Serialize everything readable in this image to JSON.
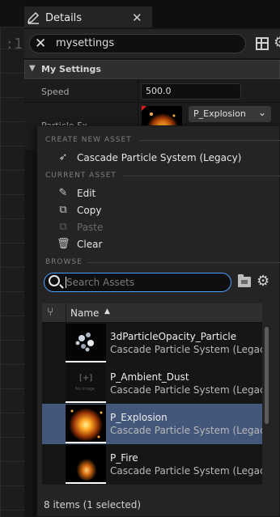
{
  "viewport": {
    "edge_text": ":1"
  },
  "tab": {
    "title": "Details",
    "icon": "pencil-icon",
    "close_icon": "close-icon"
  },
  "search": {
    "value": "mysettings"
  },
  "category": {
    "label": "My Settings"
  },
  "properties": [
    {
      "label": "Speed",
      "value": "500.0"
    },
    {
      "label": "Particle Fx",
      "value": "P_Explosion"
    }
  ],
  "menu": {
    "create_new_asset": {
      "header": "CREATE NEW ASSET",
      "item": "Cascade Particle System (Legacy)"
    },
    "current_asset": {
      "header": "CURRENT ASSET",
      "items": [
        "Edit",
        "Copy",
        "Paste",
        "Clear"
      ]
    },
    "browse": {
      "header": "BROWSE",
      "search_placeholder": "Search Assets",
      "column_name": "Name",
      "assets": [
        {
          "name": "3dParticleOpacity_Particle",
          "type": "Cascade Particle System (Legacy)",
          "selected": false
        },
        {
          "name": "P_Ambient_Dust",
          "type": "Cascade Particle System (Legacy)",
          "selected": false,
          "thumb_text": "[+]",
          "thumb_subtext": "No Image"
        },
        {
          "name": "P_Explosion",
          "type": "Cascade Particle System (Legacy)",
          "selected": true
        },
        {
          "name": "P_Fire",
          "type": "Cascade Particle System (Legacy)",
          "selected": false
        }
      ],
      "status": "8 items (1 selected)"
    }
  },
  "colors": {
    "selection": "#42577a",
    "accent_search": "#4aa0ff",
    "thumb_bar": "#ff8800"
  }
}
